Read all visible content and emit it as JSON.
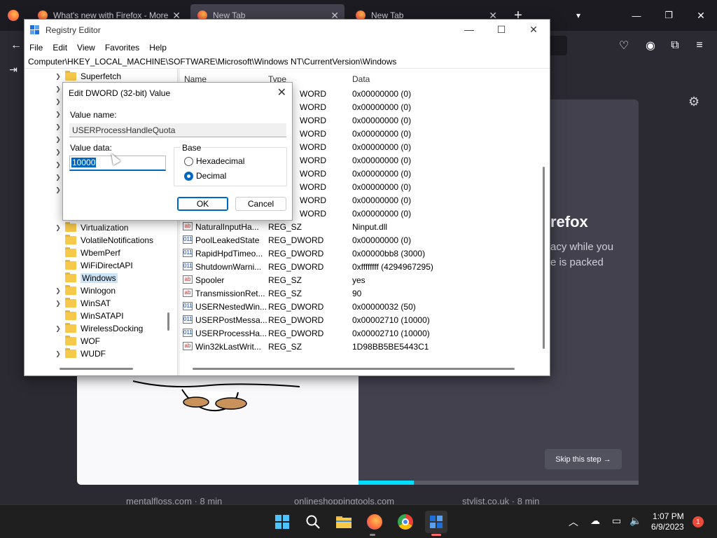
{
  "firefox": {
    "tabs": [
      {
        "title": "What's new with Firefox - More",
        "close": "✕"
      },
      {
        "title": "New Tab",
        "close": "✕"
      },
      {
        "title": "New Tab",
        "close": "✕"
      }
    ],
    "new_tab": "+",
    "window_controls": {
      "minimize": "—",
      "maximize": "❐",
      "close": "✕"
    },
    "onboarding": {
      "heading": "refox",
      "sub_line1": "acy while you",
      "sub_line2": "e is packed",
      "skip_label": "Skip this step →"
    },
    "stories": [
      "mentalfloss.com · 8 min",
      "onlineshoppingtools.com",
      "stylist.co.uk · 8 min"
    ],
    "accent": "#00ddff"
  },
  "regedit": {
    "title": "Registry Editor",
    "window_controls": {
      "minimize": "—",
      "maximize": "☐",
      "close": "✕"
    },
    "menu": [
      "File",
      "Edit",
      "View",
      "Favorites",
      "Help"
    ],
    "address": "Computer\\HKEY_LOCAL_MACHINE\\SOFTWARE\\Microsoft\\Windows NT\\CurrentVersion\\Windows",
    "tree": [
      {
        "label": "Superfetch",
        "chevron": "❯"
      },
      {
        "label": "",
        "chevron": "❯"
      },
      {
        "label": "",
        "chevron": "❯"
      },
      {
        "label": "",
        "chevron": "❯"
      },
      {
        "label": "",
        "chevron": "❯"
      },
      {
        "label": "",
        "chevron": "❯"
      },
      {
        "label": "",
        "chevron": "❯"
      },
      {
        "label": "",
        "chevron": "❯"
      },
      {
        "label": "",
        "chevron": "❯"
      },
      {
        "label": "",
        "chevron": "❯"
      },
      {
        "label": "",
        "chevron": ""
      },
      {
        "label": "Virtualization",
        "chevron": "❯"
      },
      {
        "label": "VolatileNotifications",
        "chevron": ""
      },
      {
        "label": "WbemPerf",
        "chevron": ""
      },
      {
        "label": "WiFiDirectAPI",
        "chevron": ""
      },
      {
        "label": "Windows",
        "chevron": "",
        "selected": true
      },
      {
        "label": "Winlogon",
        "chevron": "❯"
      },
      {
        "label": "WinSAT",
        "chevron": "❯"
      },
      {
        "label": "WinSATAPI",
        "chevron": ""
      },
      {
        "label": "WirelessDocking",
        "chevron": "❯"
      },
      {
        "label": "WOF",
        "chevron": ""
      },
      {
        "label": "WUDF",
        "chevron": "❯"
      }
    ],
    "columns": {
      "name": "Name",
      "type": "Type",
      "data": "Data"
    },
    "values": [
      {
        "name": "",
        "type": "WORD",
        "data": "0x00000000 (0)",
        "icon": "dword"
      },
      {
        "name": "",
        "type": "WORD",
        "data": "0x00000000 (0)",
        "icon": "dword"
      },
      {
        "name": "",
        "type": "WORD",
        "data": "0x00000000 (0)",
        "icon": "dword"
      },
      {
        "name": "",
        "type": "WORD",
        "data": "0x00000000 (0)",
        "icon": "dword"
      },
      {
        "name": "",
        "type": "WORD",
        "data": "0x00000000 (0)",
        "icon": "dword"
      },
      {
        "name": "",
        "type": "WORD",
        "data": "0x00000000 (0)",
        "icon": "dword"
      },
      {
        "name": "",
        "type": "WORD",
        "data": "0x00000000 (0)",
        "icon": "dword"
      },
      {
        "name": "",
        "type": "WORD",
        "data": "0x00000000 (0)",
        "icon": "dword"
      },
      {
        "name": "",
        "type": "WORD",
        "data": "0x00000000 (0)",
        "icon": "dword"
      },
      {
        "name": "",
        "type": "WORD",
        "data": "0x00000000 (0)",
        "icon": "dword"
      },
      {
        "name": "NaturalInputHa...",
        "type": "REG_SZ",
        "data": "Ninput.dll",
        "icon": "sz"
      },
      {
        "name": "PoolLeakedState",
        "type": "REG_DWORD",
        "data": "0x00000000 (0)",
        "icon": "dword"
      },
      {
        "name": "RapidHpdTimeo...",
        "type": "REG_DWORD",
        "data": "0x00000bb8 (3000)",
        "icon": "dword"
      },
      {
        "name": "ShutdownWarni...",
        "type": "REG_DWORD",
        "data": "0xffffffff (4294967295)",
        "icon": "dword"
      },
      {
        "name": "Spooler",
        "type": "REG_SZ",
        "data": "yes",
        "icon": "sz"
      },
      {
        "name": "TransmissionRet...",
        "type": "REG_SZ",
        "data": "90",
        "icon": "sz"
      },
      {
        "name": "USERNestedWin...",
        "type": "REG_DWORD",
        "data": "0x00000032 (50)",
        "icon": "dword"
      },
      {
        "name": "USERPostMessa...",
        "type": "REG_DWORD",
        "data": "0x00002710 (10000)",
        "icon": "dword"
      },
      {
        "name": "USERProcessHa...",
        "type": "REG_DWORD",
        "data": "0x00002710 (10000)",
        "icon": "dword"
      },
      {
        "name": "Win32kLastWrit...",
        "type": "REG_SZ",
        "data": "1D98BB5BE5443C1",
        "icon": "sz"
      }
    ]
  },
  "dialog": {
    "title": "Edit DWORD (32-bit) Value",
    "close": "✕",
    "value_name_label": "Value name:",
    "value_name": "USERProcessHandleQuota",
    "value_data_label": "Value data:",
    "value_data": "10000",
    "base_label": "Base",
    "hex_label": "Hexadecimal",
    "dec_label": "Decimal",
    "ok_label": "OK",
    "cancel_label": "Cancel",
    "selected_base": "Decimal"
  },
  "taskbar": {
    "time": "1:07 PM",
    "date": "6/9/2023",
    "notification_count": "1",
    "tray_chevron": "︿"
  }
}
